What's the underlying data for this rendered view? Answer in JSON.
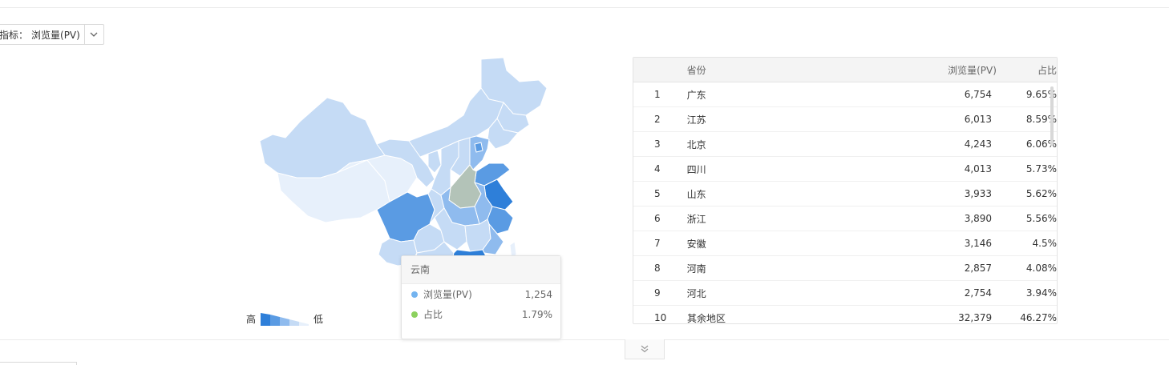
{
  "metric_select": {
    "label": "指标：",
    "value": "浏览量(PV)"
  },
  "legend": {
    "high": "高",
    "low": "低"
  },
  "tooltip": {
    "title": "云南",
    "rows": [
      {
        "name": "浏览量(PV)",
        "value": "1,254",
        "color": "#74b4f0"
      },
      {
        "name": "占比",
        "value": "1.79%",
        "color": "#8cd15e"
      }
    ]
  },
  "table": {
    "headers": {
      "province": "省份",
      "pv": "浏览量(PV)",
      "ratio": "占比"
    },
    "rows": [
      {
        "rank": "1",
        "province": "广东",
        "pv": "6,754",
        "ratio": "9.65%"
      },
      {
        "rank": "2",
        "province": "江苏",
        "pv": "6,013",
        "ratio": "8.59%"
      },
      {
        "rank": "3",
        "province": "北京",
        "pv": "4,243",
        "ratio": "6.06%"
      },
      {
        "rank": "4",
        "province": "四川",
        "pv": "4,013",
        "ratio": "5.73%"
      },
      {
        "rank": "5",
        "province": "山东",
        "pv": "3,933",
        "ratio": "5.62%"
      },
      {
        "rank": "6",
        "province": "浙江",
        "pv": "3,890",
        "ratio": "5.56%"
      },
      {
        "rank": "7",
        "province": "安徽",
        "pv": "3,146",
        "ratio": "4.5%"
      },
      {
        "rank": "8",
        "province": "河南",
        "pv": "2,857",
        "ratio": "4.08%"
      },
      {
        "rank": "9",
        "province": "河北",
        "pv": "2,754",
        "ratio": "3.94%"
      },
      {
        "rank": "10",
        "province": "其余地区",
        "pv": "32,379",
        "ratio": "46.27%"
      }
    ]
  },
  "colors": {
    "map_darkest": "#2e7fd9",
    "map_dark": "#5a9be3",
    "map_mid": "#8fbbee",
    "map_light": "#c5dbf5",
    "map_lightest": "#e7f0fb",
    "hover_region": "#b3c3b8"
  }
}
